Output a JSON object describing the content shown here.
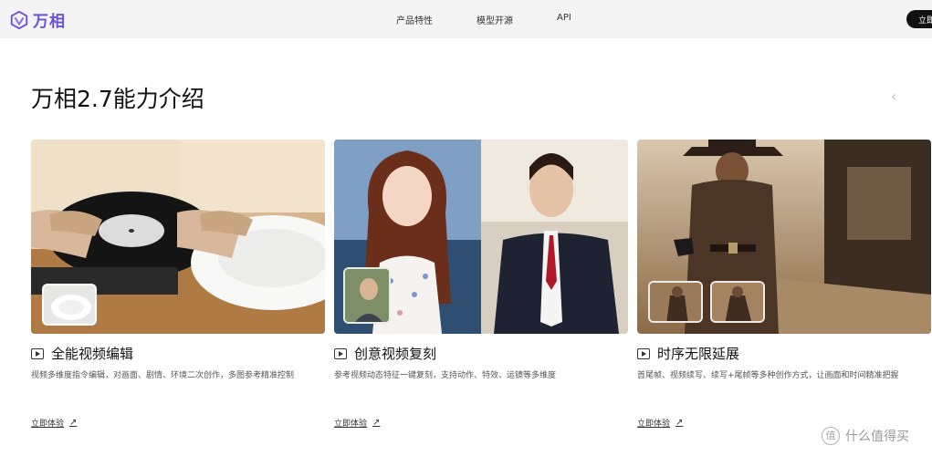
{
  "header": {
    "brand": "万相",
    "nav": [
      "产品特性",
      "模型开源",
      "API"
    ],
    "cta": "立即"
  },
  "section": {
    "title": "万相2.7能力介绍"
  },
  "cards": [
    {
      "title": "全能视频编辑",
      "desc": "视频多维度指令编辑，对画面、剧情、环境二次创作，多图参考精准控制",
      "link": "立即体验"
    },
    {
      "title": "创意视频复刻",
      "desc": "参考视频动态特征一键复刻，支持动作、特效、运镜等多维度",
      "link": "立即体验"
    },
    {
      "title": "时序无限延展",
      "desc": "首尾帧、视频续写、续写+尾帧等多种创作方式，让画面和时间精准把握",
      "link": "立即体验"
    }
  ],
  "watermark": {
    "text": "什么值得买",
    "badge": "值"
  },
  "colors": {
    "brand": "#6b4fd8",
    "cta_bg": "#111111"
  },
  "icons": [
    "wan-logo-icon",
    "chevron-left-icon",
    "play-icon",
    "arrow-up-right-icon"
  ]
}
